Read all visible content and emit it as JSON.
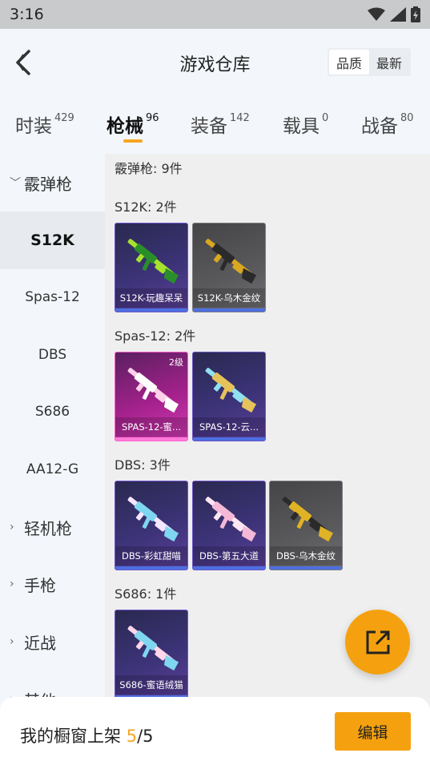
{
  "status_bar": {
    "time": "3:16",
    "wifi_icon": "wifi-icon",
    "signal_icon": "signal-icon",
    "battery_icon": "battery-charging-icon"
  },
  "header": {
    "title": "游戏仓库",
    "sort": {
      "options": [
        "品质",
        "最新"
      ],
      "selected": "品质"
    }
  },
  "tabs": [
    {
      "label": "时装",
      "count": "429"
    },
    {
      "label": "枪械",
      "count": "96",
      "active": true
    },
    {
      "label": "装备",
      "count": "142"
    },
    {
      "label": "载具",
      "count": "0"
    },
    {
      "label": "战备",
      "count": "80"
    }
  ],
  "sidebar": {
    "group_open": "霰弹枪",
    "items": [
      "S12K",
      "Spas-12",
      "DBS",
      "S686",
      "AA12-G"
    ],
    "selected": "S12K",
    "groups_closed": [
      "轻机枪",
      "手枪",
      "近战",
      "其他"
    ]
  },
  "content": {
    "category_header": "霰弹枪: 9件",
    "sections": [
      {
        "title": "S12K: 2件",
        "cards": [
          {
            "name": "S12K-玩趣呆呆",
            "rarity": "purple",
            "colors": [
              "#a6e22e",
              "#2a8f2a"
            ]
          },
          {
            "name": "S12K-乌木金纹",
            "rarity": "gray",
            "colors": [
              "#d9a820",
              "#2a2a2a"
            ]
          }
        ]
      },
      {
        "title": "Spas-12: 2件",
        "cards": [
          {
            "name": "SPAS-12-蜜...",
            "rarity": "pink",
            "level": "2级",
            "colors": [
              "#ffd1e8",
              "#ffffff"
            ]
          },
          {
            "name": "SPAS-12-云...",
            "rarity": "purple",
            "colors": [
              "#8fe0f0",
              "#e6c25a"
            ]
          }
        ]
      },
      {
        "title": "DBS: 3件",
        "cards": [
          {
            "name": "DBS-彩虹甜喵",
            "rarity": "purple",
            "colors": [
              "#f3e6ff",
              "#7fd6f0"
            ]
          },
          {
            "name": "DBS-第五大道",
            "rarity": "purple",
            "colors": [
              "#ffe6f2",
              "#f5b8d6"
            ]
          },
          {
            "name": "DBS-乌木金纹",
            "rarity": "gray",
            "colors": [
              "#2a2a2a",
              "#e0b225"
            ]
          }
        ]
      },
      {
        "title": "S686: 1件",
        "cards": [
          {
            "name": "S686-蜜语绒猫",
            "rarity": "purple",
            "colors": [
              "#ffd6ea",
              "#7fd6f0"
            ]
          }
        ]
      }
    ]
  },
  "fab": {
    "icon": "share-icon"
  },
  "footer": {
    "label": "我的橱窗上架",
    "current": "5",
    "total": "/5",
    "edit_label": "编辑"
  }
}
